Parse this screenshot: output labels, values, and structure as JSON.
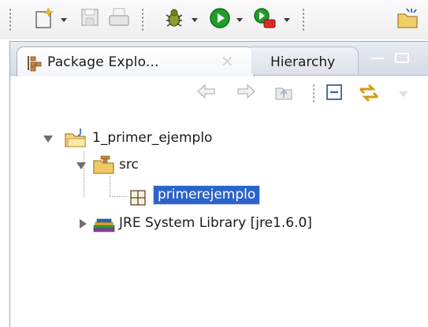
{
  "toolbar": {
    "icons": [
      "new-wizard-icon",
      "save-icon",
      "print-icon",
      "debug-icon",
      "run-icon",
      "external-tools-icon",
      "open-type-icon"
    ]
  },
  "view": {
    "active_tab": {
      "label": "Package Explo...",
      "icon": "package-explorer-icon"
    },
    "inactive_tab": {
      "label": "Hierarchy"
    },
    "view_toolbar_icons": [
      "back-icon",
      "forward-icon",
      "up-icon",
      "collapse-all-icon",
      "link-with-editor-icon",
      "view-menu-icon"
    ]
  },
  "tree": {
    "project": {
      "label": "1_primer_ejemplo",
      "icon": "java-project-icon",
      "expanded": true
    },
    "src": {
      "label": "src",
      "icon": "source-folder-icon",
      "expanded": true
    },
    "package": {
      "label": "primerejemplo",
      "icon": "package-icon",
      "selected": true
    },
    "library": {
      "label": "JRE System Library [jre1.6.0]",
      "icon": "library-icon",
      "expanded": false
    }
  },
  "colors": {
    "selection": "#2b63c9",
    "tab_bar": "#dde2ea",
    "run_green": "#1f9e2a"
  }
}
